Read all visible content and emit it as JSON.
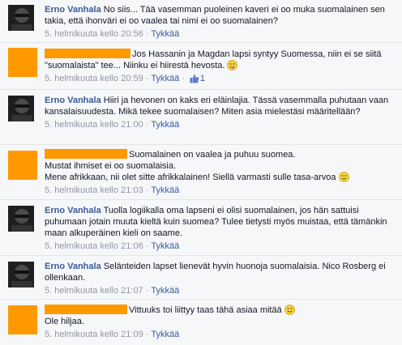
{
  "comments": [
    {
      "author": "Erno Vanhala",
      "text": "No siis... Tää vasemman puoleinen kaveri ei oo muka suomalainen sen takia, että ihonväri ei oo vaalea tai nimi ei oo suomalainen?",
      "time": "5. helmikuuta kello 20:56",
      "like": "Tykkää"
    },
    {
      "text": "Jos Hassanin ja Magdan lapsi syntyy Suomessa, niin ei se siitä \"suomalaista\" tee... Niinku ei hiirestä hevosta.",
      "emoji": "tongue-emoji",
      "time": "5. helmikuuta kello 20:59",
      "like": "Tykkää",
      "like_count": "1"
    },
    {
      "author": "Erno Vanhala",
      "text": "Hiiri ja hevonen on kaks eri eläinlajia. Tässä vasemmalla puhutaan vaan kansalaisuudesta. Mikä tekee suomalaisen? Miten asia mielestäsi määritellään?",
      "time": "5. helmikuuta kello 21:00",
      "like": "Tykkää"
    },
    {
      "line1": "Suomalainen on vaalea ja puhuu suomea.",
      "line2": "Mustat ihmiset ei oo suomalaisia.",
      "line3": "Mene afrikkaan, nii olet sitte afrikkalainen! Siellä varmasti sulle tasa-arvoa",
      "emoji": "smile-emoji",
      "time": "5. helmikuuta kello 21:03",
      "like": "Tykkää"
    },
    {
      "author": "Erno Vanhala",
      "text": "Tuolla logiikalla oma lapseni ei olisi suomalainen, jos hän sattuisi puhumaan jotain muuta kieltä kuin suomea? Tulee tietysti myös muistaa, että tämänkin maan alkuperäinen kieli on saame.",
      "time": "5. helmikuuta kello 21:06",
      "like": "Tykkää"
    },
    {
      "author": "Erno Vanhala",
      "text": "Selänteiden lapset lienevät hyvin huonoja suomalaisia. Nico Rosberg ei ollenkaan.",
      "time": "5. helmikuuta kello 21:07",
      "like": "Tykkää"
    },
    {
      "line1": "Vittuuks toi liittyy taas tähä asiaa mitää",
      "line2": "Ole hiljaa.",
      "emoji": "smile-emoji",
      "time": "5. helmikuuta kello 21:09",
      "like": "Tykkää"
    }
  ]
}
